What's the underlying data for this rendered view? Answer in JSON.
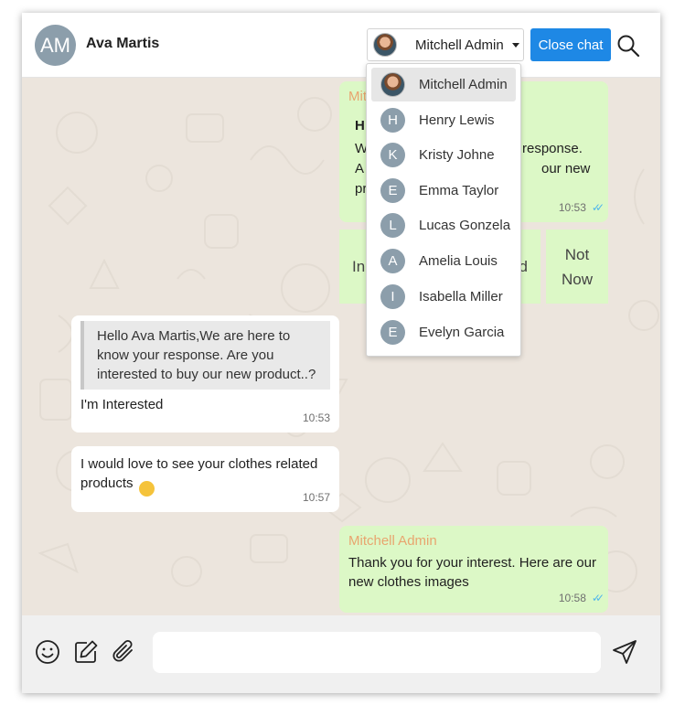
{
  "header": {
    "contact_initials": "AM",
    "contact_name": "Ava Martis",
    "agent_selected": "Mitchell Admin",
    "close_chat_label": "Close chat"
  },
  "agent_dropdown": {
    "items": [
      {
        "initial": "",
        "name": "Mitchell Admin",
        "photo": true
      },
      {
        "initial": "H",
        "name": "Henry Lewis"
      },
      {
        "initial": "K",
        "name": "Kristy Johne"
      },
      {
        "initial": "E",
        "name": "Emma Taylor"
      },
      {
        "initial": "L",
        "name": "Lucas Gonzela"
      },
      {
        "initial": "A",
        "name": "Amelia Louis"
      },
      {
        "initial": "I",
        "name": "Isabella Miller"
      },
      {
        "initial": "E",
        "name": "Evelyn Garcia"
      }
    ]
  },
  "messages": {
    "m1": {
      "sender": "Mitchell Admin",
      "partial_sender": "Mit",
      "bold_partial": "H",
      "right_line1": "response.",
      "right_line2": "our new",
      "left_line1": "W",
      "left_line2": "A",
      "left_line3": "pr",
      "time": "10:53"
    },
    "quick_replies": {
      "interested_partial_left": "In",
      "interested_partial_right": "d",
      "not_now": "Not Now"
    },
    "m2": {
      "quote": "Hello Ava Martis,We are here to know your response. Are you interested to buy our new product..?",
      "text": "I'm Interested",
      "time": "10:53"
    },
    "m3": {
      "text": "I would love to see your clothes related products",
      "emoji": "🙂",
      "time": "10:57"
    },
    "m4": {
      "sender": "Mitchell Admin",
      "text": "Thank you for your interest. Here are our new clothes images",
      "time": "10:58"
    }
  },
  "footer": {
    "input_value": "",
    "input_placeholder": ""
  },
  "colors": {
    "primary": "#1e88e5",
    "outgoing_bubble": "#dcf8c6",
    "incoming_bubble": "#ffffff",
    "chat_background": "#ece5dd",
    "sender_name": "#e8a56f",
    "read_ticks": "#4fb6ec"
  },
  "icons": [
    "search-icon",
    "emoji-icon",
    "template-edit-icon",
    "paperclip-icon",
    "send-icon",
    "read-ticks-icon"
  ]
}
